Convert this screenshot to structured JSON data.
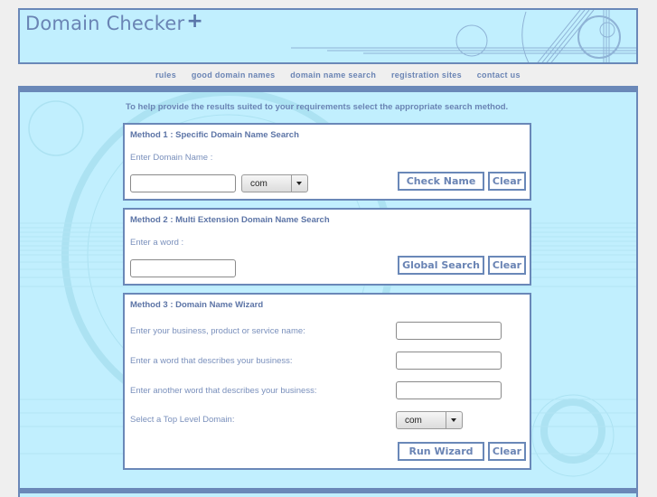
{
  "header": {
    "logo_text": "Domain Checker",
    "logo_plus": "+"
  },
  "nav": {
    "items": [
      "rules",
      "good domain names",
      "domain name search",
      "registration sites",
      "contact us"
    ]
  },
  "intro": "To help provide the results suited to your requirements select the appropriate search method.",
  "method1": {
    "title": "Method 1 : Specific Domain Name Search",
    "label": "Enter Domain Name :",
    "domain_value": "",
    "extension_selected": "com",
    "check_button": "Check Name",
    "clear_button": "Clear"
  },
  "method2": {
    "title": "Method 2 : Multi Extension Domain Name Search",
    "label": "Enter a word :",
    "word_value": "",
    "search_button": "Global Search",
    "clear_button": "Clear"
  },
  "method3": {
    "title": "Method 3 : Domain Name Wizard",
    "fields": [
      {
        "label": "Enter your business, product or service name:",
        "value": ""
      },
      {
        "label": "Enter a word that describes your business:",
        "value": ""
      },
      {
        "label": "Enter another word that describes your business:",
        "value": ""
      }
    ],
    "tld_label": "Select a Top Level Domain:",
    "tld_selected": "com",
    "run_button": "Run Wizard",
    "clear_button": "Clear"
  }
}
